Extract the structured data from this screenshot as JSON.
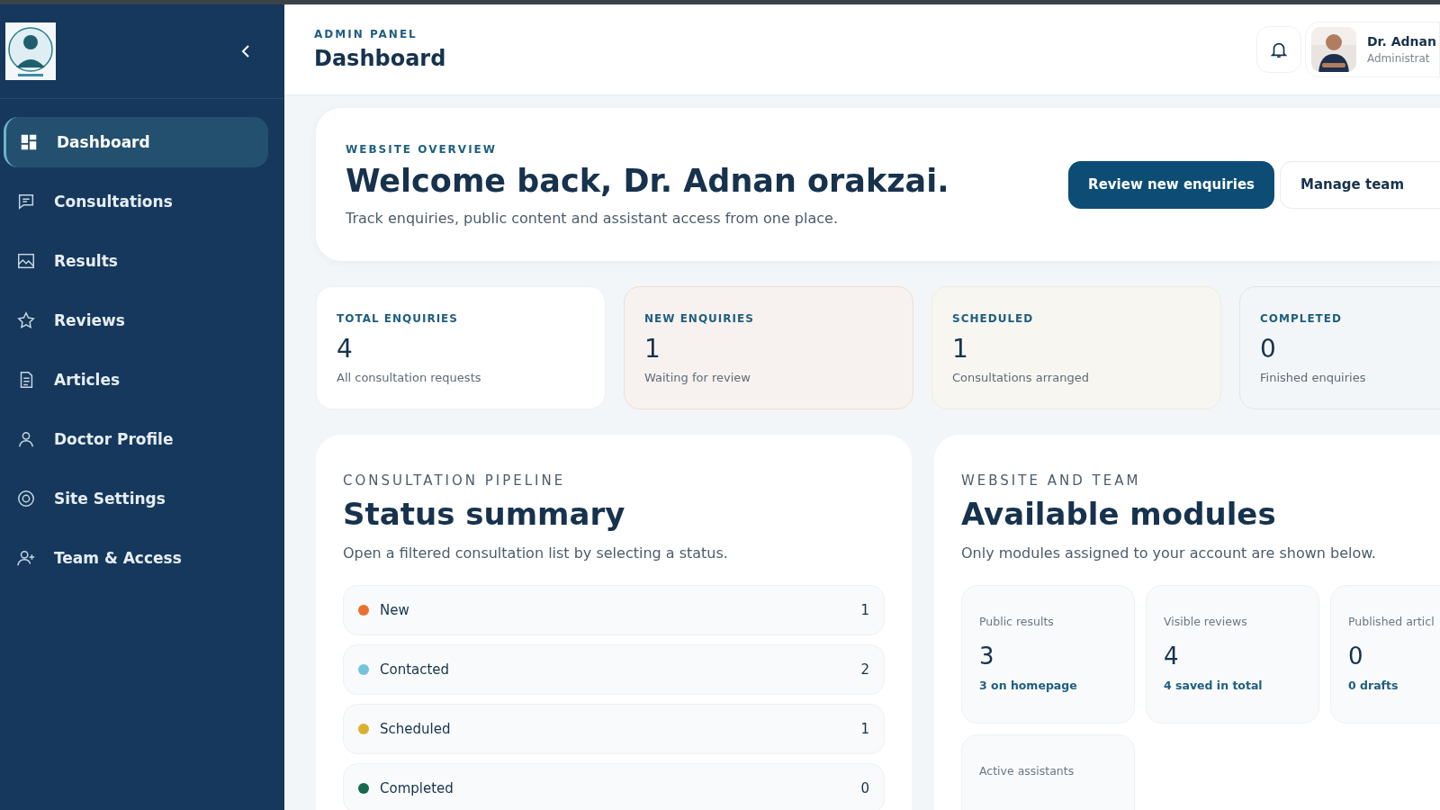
{
  "sidebar": {
    "items": [
      {
        "label": "Dashboard",
        "selected": true
      },
      {
        "label": "Consultations",
        "selected": false
      },
      {
        "label": "Results",
        "selected": false
      },
      {
        "label": "Reviews",
        "selected": false
      },
      {
        "label": "Articles",
        "selected": false
      },
      {
        "label": "Doctor Profile",
        "selected": false
      },
      {
        "label": "Site Settings",
        "selected": false
      },
      {
        "label": "Team & Access",
        "selected": false
      }
    ]
  },
  "header": {
    "eyebrow": "ADMIN PANEL",
    "title": "Dashboard",
    "user": {
      "name": "Dr. Adnan",
      "role": "Administrat"
    }
  },
  "welcome": {
    "eyebrow": "WEBSITE OVERVIEW",
    "title": "Welcome back, Dr. Adnan orakzai.",
    "text": "Track enquiries, public content and assistant access from one place.",
    "buttons": [
      {
        "label": "Review new enquiries",
        "kind": "primary"
      },
      {
        "label": "Manage team",
        "kind": "secondary"
      }
    ]
  },
  "stats": [
    {
      "label": "TOTAL ENQUIRIES",
      "value": "4",
      "note": "All consultation requests"
    },
    {
      "label": "NEW ENQUIRIES",
      "value": "1",
      "note": "Waiting for review"
    },
    {
      "label": "SCHEDULED",
      "value": "1",
      "note": "Consultations arranged"
    },
    {
      "label": "COMPLETED",
      "value": "0",
      "note": "Finished enquiries"
    }
  ],
  "pipeline": {
    "eyebrow": "CONSULTATION PIPELINE",
    "title": "Status summary",
    "text": "Open a filtered consultation list by selecting a status.",
    "statuses": [
      {
        "label": "New",
        "count": "1",
        "color": "#e8712f"
      },
      {
        "label": "Contacted",
        "count": "2",
        "color": "#74c4da"
      },
      {
        "label": "Scheduled",
        "count": "1",
        "color": "#d9b12e"
      },
      {
        "label": "Completed",
        "count": "0",
        "color": "#17684f"
      }
    ]
  },
  "modules": {
    "eyebrow": "WEBSITE AND TEAM",
    "title": "Available modules",
    "text": "Only modules assigned to your account are shown below.",
    "items": [
      {
        "label": "Public results",
        "value": "3",
        "note": "3 on homepage"
      },
      {
        "label": "Visible reviews",
        "value": "4",
        "note": "4 saved in total"
      },
      {
        "label": "Published articl",
        "value": "0",
        "note": "0 drafts"
      },
      {
        "label": "Active assistants"
      }
    ]
  }
}
